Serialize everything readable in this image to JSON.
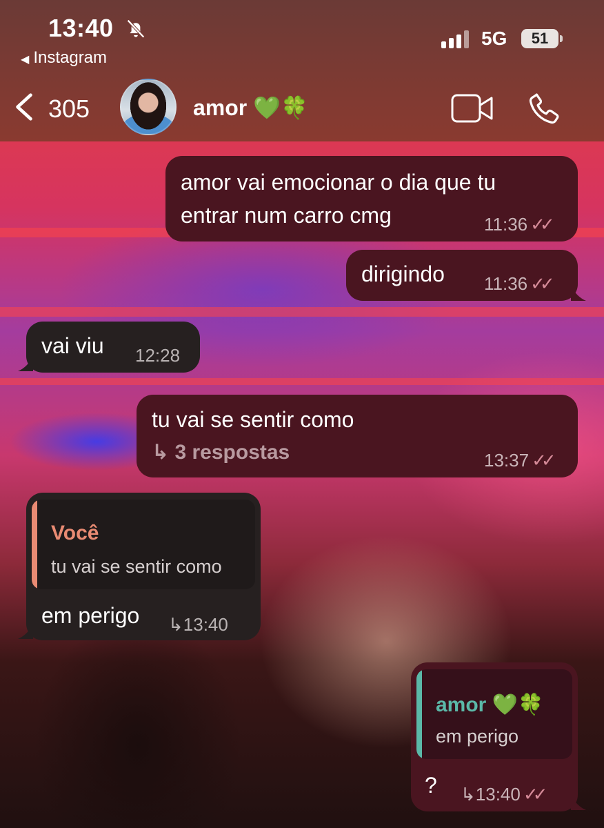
{
  "status_bar": {
    "time": "13:40",
    "back_app": "Instagram",
    "network": "5G",
    "battery": "51"
  },
  "header": {
    "unread_count": "305",
    "contact_name": "amor 💚🍀"
  },
  "messages": [
    {
      "type": "outgoing",
      "text_line1": "amor vai emocionar o dia que tu",
      "text_line2": "entrar num carro cmg",
      "time": "11:36",
      "status": "✓✓"
    },
    {
      "type": "outgoing",
      "text": "dirigindo",
      "time": "11:36",
      "status": "✓✓"
    },
    {
      "type": "incoming",
      "text": "vai viu",
      "time": "12:28"
    },
    {
      "type": "outgoing",
      "text": "tu vai se sentir como",
      "replies": "3 respostas",
      "replies_arrow": "↳",
      "time": "13:37",
      "status": "✓✓"
    },
    {
      "type": "incoming",
      "reply_to_name": "Você",
      "reply_to_text": "tu vai se sentir como",
      "text": "em perigo",
      "time": "↳13:40"
    },
    {
      "type": "outgoing",
      "reply_to_name": "amor 💚🍀",
      "reply_to_text": "em perigo",
      "text": "?",
      "time": "↳13:40",
      "status": "✓✓"
    }
  ],
  "colors": {
    "outgoing_bubble": "#4a1520",
    "incoming_bubble": "#262020",
    "reply_accent_incoming": "#e98b73",
    "reply_accent_outgoing": "#5bb8a8"
  },
  "icons": [
    "bell-slash-icon",
    "back-chevron-icon",
    "video-call-icon",
    "phone-call-icon",
    "read-receipt-icon"
  ]
}
